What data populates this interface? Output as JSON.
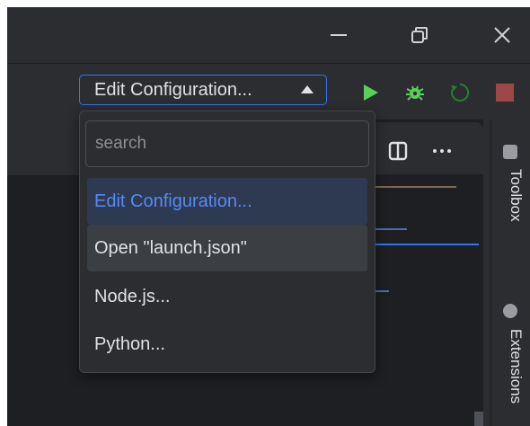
{
  "window": {
    "minimize_icon": "minimize-icon",
    "restore_icon": "restore-icon",
    "close_icon": "close-icon"
  },
  "toolbar": {
    "config_label": "Edit Configuration...",
    "run_icon": "run-play-icon",
    "debug_icon": "debug-bug-icon",
    "restart_icon": "restart-icon",
    "stop_icon": "stop-icon",
    "colors": {
      "accent": "#3574f0",
      "run": "#57d15a",
      "stop": "#c94f4f"
    }
  },
  "editor_tabs": {
    "split_icon": "split-editor-icon",
    "more_icon": "more-actions-icon"
  },
  "dropdown": {
    "search_placeholder": "search",
    "items": [
      {
        "label": "Edit Configuration...",
        "state": "active"
      },
      {
        "label": "Open \"launch.json\"",
        "state": "hover"
      },
      {
        "label": "Node.js..."
      },
      {
        "label": "Python..."
      }
    ]
  },
  "right_strip": {
    "toolbox_label": "Toolbox",
    "extensions_label": "Extensions"
  }
}
